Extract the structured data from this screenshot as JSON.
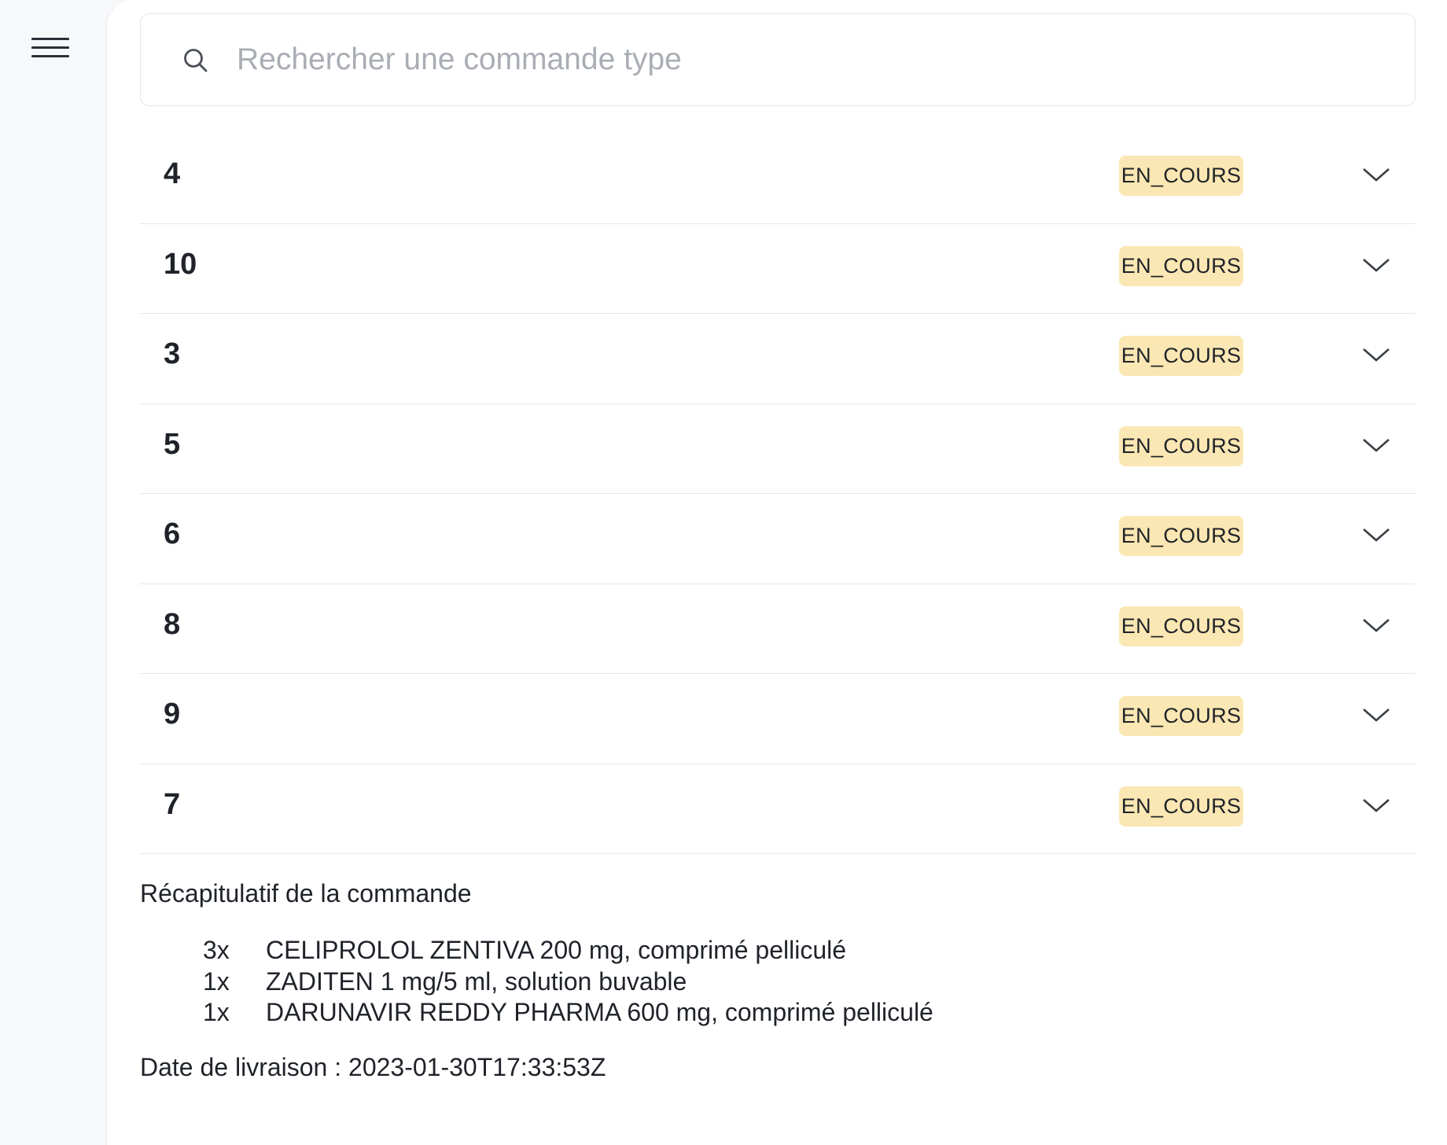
{
  "search": {
    "placeholder": "Rechercher une commande type",
    "value": ""
  },
  "orders": [
    {
      "title": "4",
      "status": "EN_COURS"
    },
    {
      "title": "10",
      "status": "EN_COURS"
    },
    {
      "title": "3",
      "status": "EN_COURS"
    },
    {
      "title": "5",
      "status": "EN_COURS"
    },
    {
      "title": "6",
      "status": "EN_COURS"
    },
    {
      "title": "8",
      "status": "EN_COURS"
    },
    {
      "title": "9",
      "status": "EN_COURS"
    },
    {
      "title": "7",
      "status": "EN_COURS"
    }
  ],
  "summary": {
    "title": "Récapitulatif de la commande",
    "items": [
      {
        "qty": "3x",
        "name": "CELIPROLOL ZENTIVA 200 mg, comprimé pelliculé"
      },
      {
        "qty": "1x",
        "name": "ZADITEN 1 mg/5 ml, solution buvable"
      },
      {
        "qty": "1x",
        "name": "DARUNAVIR REDDY PHARMA 600 mg, comprimé pelliculé"
      }
    ],
    "delivery_label": "Date de livraison :",
    "delivery_value": "2023-01-30T17:33:53Z"
  },
  "colors": {
    "badge_bg": "#fbe7b3",
    "placeholder": "#a9adb4",
    "divider": "#e6e8ec"
  },
  "icons": {
    "menu": "hamburger-menu-icon",
    "search": "search-icon",
    "expand": "chevron-down-icon"
  }
}
